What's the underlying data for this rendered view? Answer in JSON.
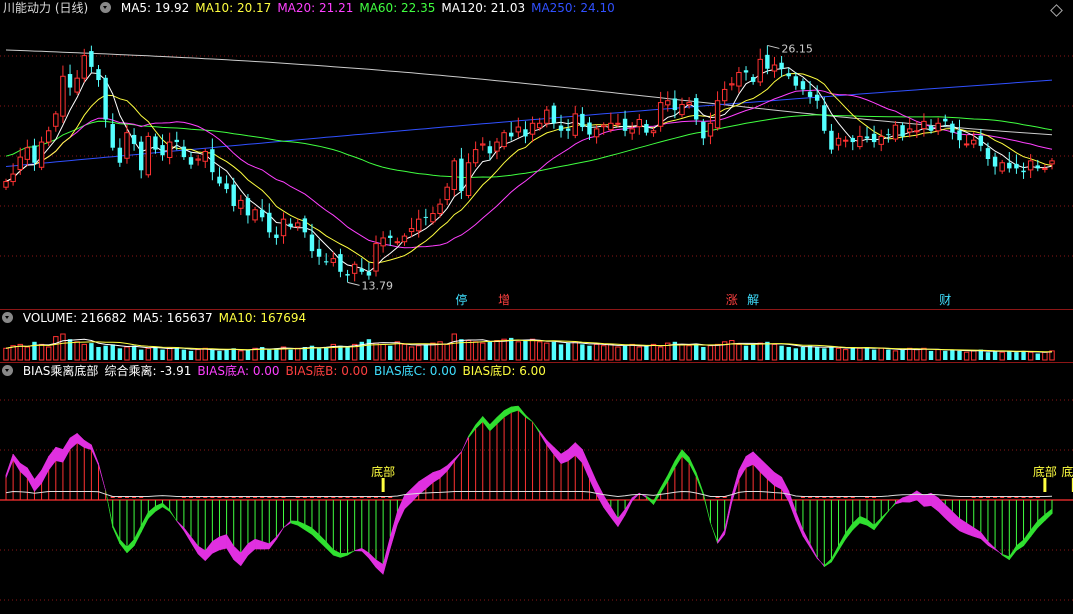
{
  "main_pane": {
    "title": "川能动力 (日线)",
    "legend": [
      {
        "label": "MA5: 19.92",
        "color": "#ffffff"
      },
      {
        "label": "MA10: 20.17",
        "color": "#ffff40"
      },
      {
        "label": "MA20: 21.21",
        "color": "#ff40ff"
      },
      {
        "label": "MA60: 22.35",
        "color": "#40ff40"
      },
      {
        "label": "MA120: 21.03",
        "color": "#ffffff"
      },
      {
        "label": "MA250: 24.10",
        "color": "#3050ff"
      }
    ],
    "high_label": "26.15",
    "low_label": "13.79",
    "event_markers": [
      {
        "text": "停",
        "color": "#40e0ff",
        "index": 64
      },
      {
        "text": "增",
        "color": "#ff4040",
        "index": 70
      },
      {
        "text": "涨",
        "color": "#ff4040",
        "index": 102
      },
      {
        "text": "解",
        "color": "#40e0ff",
        "index": 105
      },
      {
        "text": "财",
        "color": "#40e0ff",
        "index": 132
      }
    ]
  },
  "volume_pane": {
    "legend": [
      {
        "label": "VOLUME: 216682",
        "color": "#ffffff"
      },
      {
        "label": "MA5: 165637",
        "color": "#ffffff"
      },
      {
        "label": "MA10: 167694",
        "color": "#ffff40"
      }
    ]
  },
  "bias_pane": {
    "legend": [
      {
        "label": "BIAS乘离底部",
        "color": "#ffffff"
      },
      {
        "label": "综合乘离: -3.91",
        "color": "#ffffff"
      },
      {
        "label": "BIAS底A: 0.00",
        "color": "#ff40ff"
      },
      {
        "label": "BIAS底B: 0.00",
        "color": "#ff4040"
      },
      {
        "label": "BIAS底C: 0.00",
        "color": "#40e0ff"
      },
      {
        "label": "BIAS底D: 6.00",
        "color": "#ffff40"
      }
    ],
    "signal_labels": [
      {
        "text": "底部",
        "index": 53
      },
      {
        "text": "底部",
        "index": 146
      },
      {
        "text": "底部",
        "index": 150
      }
    ]
  },
  "chart_data": {
    "type": "candlestick",
    "price_range": [
      12.5,
      27.5
    ],
    "closes": [
      18.8,
      19.2,
      20.1,
      20.6,
      19.8,
      20.9,
      21.5,
      22.4,
      24.4,
      23.8,
      24.3,
      25.5,
      24.9,
      24.2,
      22.1,
      20.6,
      19.8,
      21.4,
      20.8,
      19.4,
      21.2,
      20.5,
      20.2,
      20.9,
      20.9,
      20.1,
      19.7,
      20.0,
      20.4,
      19.3,
      18.7,
      18.4,
      17.5,
      17.8,
      17.0,
      17.3,
      16.9,
      16.1,
      15.8,
      16.8,
      16.4,
      16.6,
      16.1,
      15.1,
      14.8,
      14.5,
      14.7,
      14.0,
      13.8,
      14.4,
      14.0,
      13.8,
      15.5,
      15.8,
      15.8,
      15.6,
      15.9,
      16.3,
      16.8,
      16.9,
      17.1,
      17.6,
      18.5,
      19.9,
      18.3,
      19.8,
      20.5,
      20.8,
      20.3,
      20.9,
      21.4,
      21.2,
      21.7,
      21.2,
      21.9,
      21.9,
      22.6,
      21.9,
      21.5,
      21.5,
      22.4,
      21.7,
      21.3,
      21.6,
      21.8,
      21.9,
      21.9,
      21.5,
      21.6,
      22.1,
      21.4,
      21.5,
      23.0,
      23.1,
      22.6,
      22.9,
      23.0,
      22.1,
      21.1,
      21.9,
      23.1,
      23.7,
      24.0,
      24.6,
      24.6,
      24.1,
      25.3,
      24.8,
      25.0,
      24.8,
      24.4,
      23.9,
      23.7,
      23.3,
      23.1,
      21.5,
      20.5,
      21.1,
      21.0,
      20.9,
      21.2,
      21.1,
      20.9,
      21.2,
      21.3,
      21.8,
      21.2,
      21.6,
      21.5,
      22.0,
      21.5,
      21.9,
      22.0,
      21.4,
      21.0,
      20.8,
      21.0,
      20.7,
      20.0,
      19.6,
      19.8,
      19.5,
      19.5,
      19.3,
      19.9,
      19.5,
      19.5,
      19.9
    ],
    "volumes": [
      0.45,
      0.55,
      0.6,
      0.5,
      0.7,
      0.6,
      0.5,
      0.9,
      1.0,
      0.8,
      0.7,
      0.6,
      0.65,
      0.5,
      0.55,
      0.6,
      0.45,
      0.5,
      0.55,
      0.4,
      0.45,
      0.5,
      0.4,
      0.45,
      0.5,
      0.4,
      0.35,
      0.4,
      0.45,
      0.4,
      0.35,
      0.4,
      0.45,
      0.35,
      0.4,
      0.45,
      0.5,
      0.4,
      0.45,
      0.5,
      0.4,
      0.45,
      0.5,
      0.55,
      0.45,
      0.5,
      0.6,
      0.55,
      0.5,
      0.6,
      0.7,
      0.8,
      0.65,
      0.6,
      0.55,
      0.7,
      0.6,
      0.5,
      0.55,
      0.6,
      0.65,
      0.7,
      0.6,
      1.0,
      0.8,
      0.75,
      0.7,
      0.65,
      0.7,
      0.75,
      0.8,
      0.85,
      0.7,
      0.75,
      0.8,
      0.7,
      0.65,
      0.7,
      0.6,
      0.65,
      0.7,
      0.6,
      0.55,
      0.6,
      0.55,
      0.6,
      0.5,
      0.55,
      0.6,
      0.5,
      0.55,
      0.6,
      0.5,
      0.65,
      0.7,
      0.6,
      0.55,
      0.6,
      0.5,
      0.55,
      0.6,
      0.7,
      0.75,
      0.6,
      0.55,
      0.6,
      0.65,
      0.7,
      0.6,
      0.55,
      0.5,
      0.45,
      0.5,
      0.55,
      0.5,
      0.45,
      0.5,
      0.45,
      0.4,
      0.5,
      0.45,
      0.5,
      0.4,
      0.45,
      0.4,
      0.35,
      0.4,
      0.45,
      0.4,
      0.45,
      0.35,
      0.4,
      0.35,
      0.4,
      0.35,
      0.3,
      0.35,
      0.4,
      0.3,
      0.35,
      0.3,
      0.35,
      0.3,
      0.35,
      0.3,
      0.25,
      0.3,
      0.35
    ],
    "bias_values": [
      1.1,
      2.0,
      1.6,
      1.4,
      0.9,
      1.3,
      1.9,
      2.3,
      2.2,
      2.7,
      2.9,
      2.6,
      2.4,
      1.6,
      0.4,
      -1.2,
      -1.9,
      -2.3,
      -2.0,
      -1.4,
      -0.8,
      -0.5,
      -0.3,
      -0.5,
      -0.9,
      -1.2,
      -1.6,
      -2.0,
      -2.2,
      -1.8,
      -1.6,
      -1.5,
      -2.0,
      -2.3,
      -1.9,
      -1.7,
      -1.8,
      -1.9,
      -1.6,
      -1.2,
      -1.0,
      -1.1,
      -1.3,
      -1.5,
      -1.8,
      -2.1,
      -2.4,
      -2.5,
      -2.4,
      -2.2,
      -2.1,
      -2.3,
      -2.6,
      -2.8,
      -1.6,
      -0.5,
      0.2,
      0.5,
      0.8,
      1.0,
      1.2,
      1.3,
      1.5,
      1.8,
      2.1,
      2.7,
      3.1,
      3.4,
      3.0,
      3.3,
      3.6,
      3.8,
      3.9,
      3.6,
      3.4,
      3.0,
      2.6,
      2.3,
      2.0,
      2.2,
      2.5,
      2.2,
      1.5,
      0.8,
      0.2,
      -0.3,
      -0.8,
      -0.4,
      0.1,
      0.3,
      0.1,
      -0.2,
      0.3,
      0.8,
      1.4,
      1.9,
      1.6,
      1.0,
      0.2,
      -1.0,
      -1.8,
      -1.3,
      0.2,
      1.3,
      1.9,
      2.1,
      1.8,
      1.5,
      1.2,
      1.0,
      0.4,
      -0.5,
      -1.3,
      -1.9,
      -2.5,
      -2.9,
      -2.7,
      -2.2,
      -1.7,
      -1.3,
      -1.0,
      -1.1,
      -1.3,
      -0.9,
      -0.5,
      -0.1,
      0.1,
      0.2,
      0.4,
      0.2,
      0.3,
      0.1,
      -0.2,
      -0.5,
      -0.8,
      -1.0,
      -1.2,
      -1.4,
      -1.8,
      -2.1,
      -2.4,
      -2.6,
      -2.2,
      -2.0,
      -1.6,
      -1.2,
      -0.9,
      -0.6
    ]
  }
}
